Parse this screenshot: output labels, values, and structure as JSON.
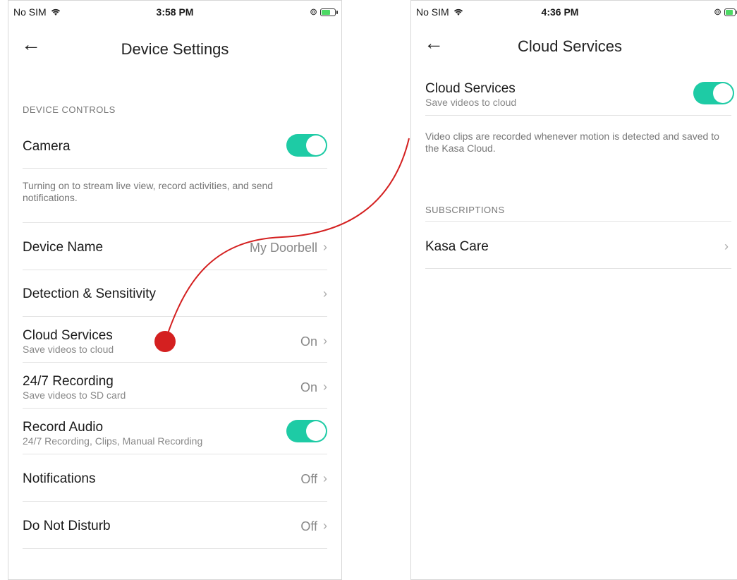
{
  "left": {
    "status": {
      "carrier": "No SIM",
      "time": "3:58 PM"
    },
    "nav": {
      "title": "Device Settings"
    },
    "device_controls_header": "DEVICE CONTROLS",
    "camera": {
      "label": "Camera",
      "on": true
    },
    "camera_desc": "Turning on to stream live view, record activities, and send notifications.",
    "device_name": {
      "label": "Device Name",
      "value": "My Doorbell"
    },
    "detection": {
      "label": "Detection & Sensitivity"
    },
    "cloud": {
      "label": "Cloud Services",
      "sub": "Save videos to cloud",
      "value": "On"
    },
    "recording": {
      "label": "24/7 Recording",
      "sub": "Save videos to SD card",
      "value": "On"
    },
    "audio": {
      "label": "Record Audio",
      "sub": "24/7 Recording, Clips, Manual Recording",
      "on": true
    },
    "notifications": {
      "label": "Notifications",
      "value": "Off"
    },
    "dnd": {
      "label": "Do Not Disturb",
      "value": "Off"
    }
  },
  "right": {
    "status": {
      "carrier": "No SIM",
      "time": "4:36 PM"
    },
    "nav": {
      "title": "Cloud Services"
    },
    "cloud": {
      "label": "Cloud Services",
      "sub": "Save videos to cloud",
      "on": true
    },
    "desc": "Video clips are recorded whenever motion is detected and saved to the Kasa Cloud.",
    "subscriptions_header": "SUBSCRIPTIONS",
    "kasa_care": {
      "label": "Kasa Care"
    }
  },
  "icons": {
    "back": "←",
    "chevron": "›",
    "wifi": "wifi-icon",
    "rotation_lock": "rotation-lock-icon",
    "battery": "battery-charging-icon"
  },
  "colors": {
    "toggle_on": "#1ecba5",
    "annotation": "#d42020"
  }
}
